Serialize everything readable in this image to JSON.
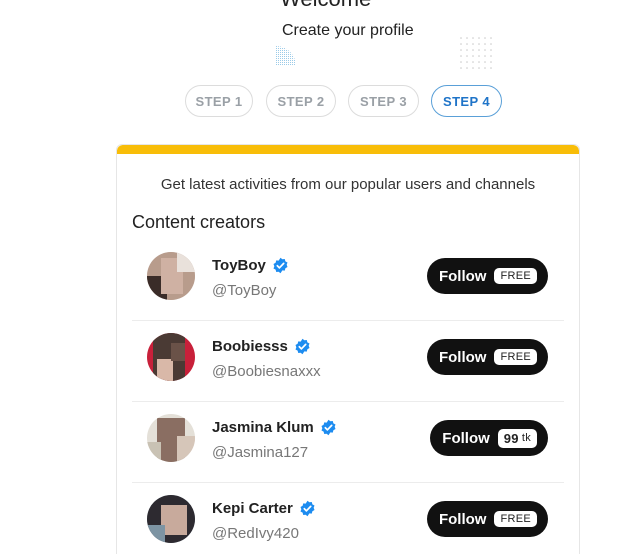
{
  "header": {
    "title": "Welcome",
    "subtitle": "Create your profile"
  },
  "steps": [
    {
      "label": "STEP 1",
      "active": false
    },
    {
      "label": "STEP 2",
      "active": false
    },
    {
      "label": "STEP 3",
      "active": false
    },
    {
      "label": "STEP 4",
      "active": true
    }
  ],
  "card": {
    "accent_color": "#f8bd08",
    "intro": "Get latest activities from our popular users and channels",
    "section_title": "Content creators",
    "creators": [
      {
        "name": "ToyBoy",
        "handle": "@ToyBoy",
        "verified": true,
        "follow_label": "Follow",
        "price": "FREE"
      },
      {
        "name": "Boobiesss",
        "handle": "@Boobiesnaxxx",
        "verified": true,
        "follow_label": "Follow",
        "price": "FREE"
      },
      {
        "name": "Jasmina Klum",
        "handle": "@Jasmina127",
        "verified": true,
        "follow_label": "Follow",
        "price_value": "99",
        "price_unit": "tk"
      },
      {
        "name": "Kepi Carter",
        "handle": "@RedIvy420",
        "verified": true,
        "follow_label": "Follow",
        "price": "FREE"
      }
    ]
  },
  "colors": {
    "active_step": "#1f74c8",
    "verified_badge": "#1d8cf0",
    "button_bg": "#111111"
  }
}
